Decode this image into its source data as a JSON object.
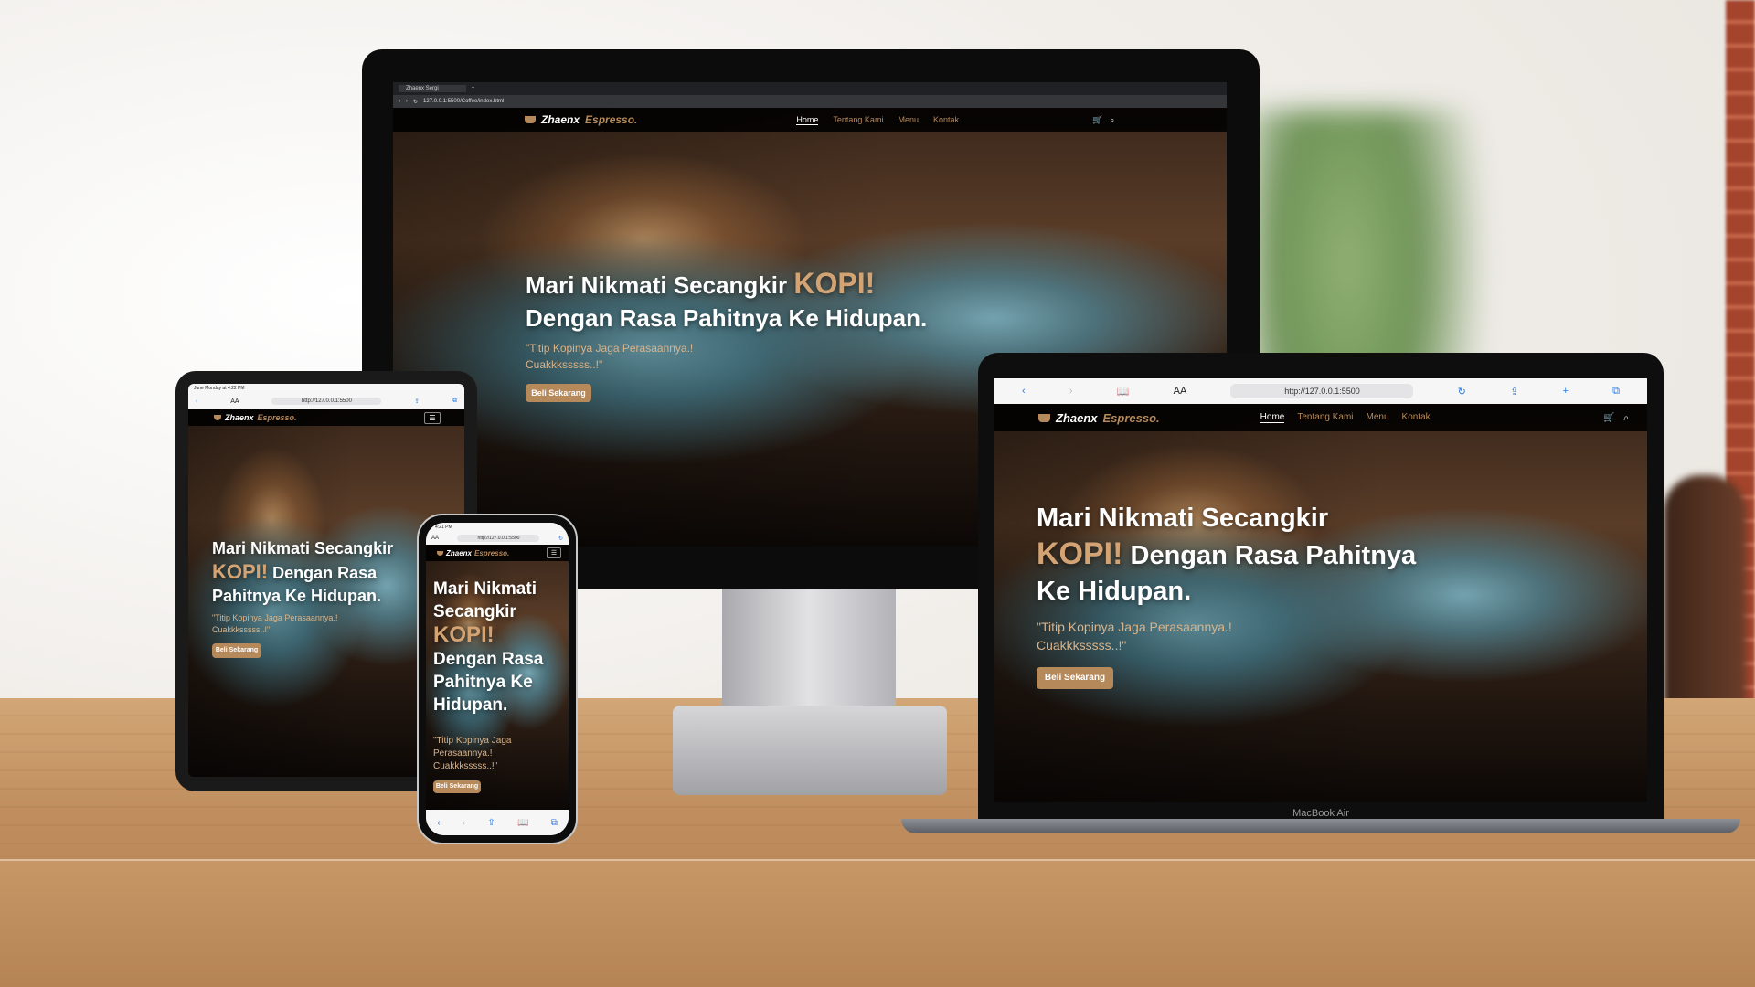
{
  "site": {
    "logo_main": "Zhaenx",
    "logo_accent": "Espresso.",
    "nav": [
      "Home",
      "Tentang Kami",
      "Menu",
      "Kontak"
    ],
    "headline_a": "Mari Nikmati Secangkir ",
    "headline_kopi": "KOPI!",
    "headline_b": "Dengan Rasa Pahitnya Ke Hidupan.",
    "quote": "\"Titip Kopinya Jaga Perasaannya.! Cuakkksssss..!\"",
    "cta": "Beli Sekarang"
  },
  "monitor": {
    "tab_title": "Zhaenx Sergi",
    "url": "127.0.0.1:5500/Coffee/index.html"
  },
  "laptop": {
    "url_aa": "AA",
    "url": "http://127.0.0.1:5500",
    "brand_label": "MacBook Air"
  },
  "tablet": {
    "status": "June Monday at 4:22 PM",
    "url_aa": "AA",
    "url": "http://127.0.0.1:5500"
  },
  "phone": {
    "time": "4:21 PM",
    "url_aa": "AA",
    "url": "http://127.0.0.1:5500"
  },
  "icons": {
    "cart": "🛒",
    "search": "⌕",
    "menu": "☰",
    "back": "‹",
    "forward": "›",
    "book": "📖",
    "share": "⇪",
    "plus": "+",
    "tabs": "⧉",
    "reload": "↻"
  },
  "colors": {
    "accent": "#b6895b",
    "kopi": "#d4a373",
    "navbg": "#000000"
  }
}
